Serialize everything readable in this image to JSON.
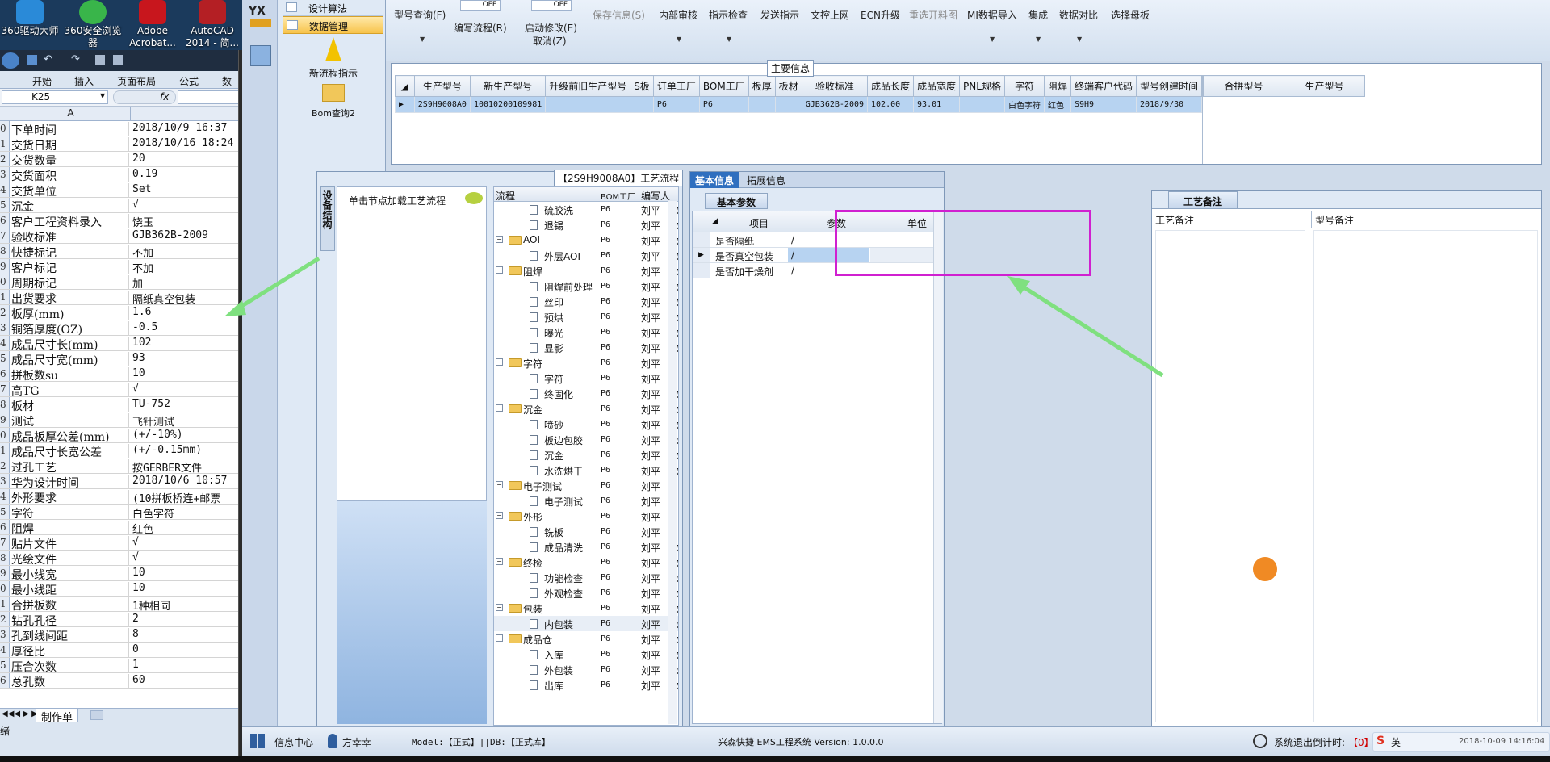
{
  "desktop": {
    "icons": [
      {
        "line1": "360驱动大师",
        "line2": ""
      },
      {
        "line1": "360安全浏览",
        "line2": "器"
      },
      {
        "line1": "Adobe",
        "line2": "Acrobat..."
      },
      {
        "line1": "AutoCAD",
        "line2": "2014 - 简..."
      }
    ]
  },
  "excel": {
    "ribbon_tabs": [
      "开始",
      "插入",
      "页面布局",
      "公式",
      "数据"
    ],
    "name_box": "K25",
    "fx": "fx",
    "column_a": "A",
    "rows": [
      {
        "num": "0",
        "a": "下单时间",
        "b": "2018/10/9 16:37"
      },
      {
        "num": "1",
        "a": "交货日期",
        "b": "2018/10/16 18:24"
      },
      {
        "num": "2",
        "a": "交货数量",
        "b": "20"
      },
      {
        "num": "3",
        "a": "交货面积",
        "b": "0.19"
      },
      {
        "num": "4",
        "a": "交货单位",
        "b": "Set"
      },
      {
        "num": "5",
        "a": "沉金",
        "b": "√"
      },
      {
        "num": "6",
        "a": "客户工程资料录入",
        "b": "饶玉"
      },
      {
        "num": "7",
        "a": "验收标准",
        "b": "GJB362B-2009"
      },
      {
        "num": "8",
        "a": "快捷标记",
        "b": "不加"
      },
      {
        "num": "9",
        "a": "客户标记",
        "b": "不加"
      },
      {
        "num": "0",
        "a": "周期标记",
        "b": "加"
      },
      {
        "num": "1",
        "a": "出货要求",
        "b": "隔纸真空包装"
      },
      {
        "num": "2",
        "a": "板厚(mm)",
        "b": "1.6"
      },
      {
        "num": "3",
        "a": "铜箔厚度(OZ)",
        "b": "-0.5"
      },
      {
        "num": "4",
        "a": "成品尺寸长(mm)",
        "b": "102"
      },
      {
        "num": "5",
        "a": "成品尺寸宽(mm)",
        "b": "93"
      },
      {
        "num": "6",
        "a": "拼板数su",
        "b": "10"
      },
      {
        "num": "7",
        "a": "高TG",
        "b": "√"
      },
      {
        "num": "8",
        "a": "板材",
        "b": "TU-752"
      },
      {
        "num": "9",
        "a": "测试",
        "b": "飞针测试"
      },
      {
        "num": "0",
        "a": "成品板厚公差(mm)",
        "b": "(+/-10%)"
      },
      {
        "num": "1",
        "a": "成品尺寸长宽公差",
        "b": "(+/-0.15mm)"
      },
      {
        "num": "2",
        "a": "过孔工艺",
        "b": "按GERBER文件"
      },
      {
        "num": "3",
        "a": "华为设计时间",
        "b": "2018/10/6 10:57"
      },
      {
        "num": "4",
        "a": "外形要求",
        "b": "(10拼板桥连+邮票"
      },
      {
        "num": "5",
        "a": "字符",
        "b": "白色字符"
      },
      {
        "num": "6",
        "a": "阻焊",
        "b": "红色"
      },
      {
        "num": "7",
        "a": "贴片文件",
        "b": "√"
      },
      {
        "num": "8",
        "a": "光绘文件",
        "b": "√"
      },
      {
        "num": "9",
        "a": "最小线宽",
        "b": "10"
      },
      {
        "num": "0",
        "a": "最小线距",
        "b": "10"
      },
      {
        "num": "1",
        "a": "合拼板数",
        "b": "1种相同"
      },
      {
        "num": "2",
        "a": "钻孔孔径",
        "b": "2"
      },
      {
        "num": "3",
        "a": "孔到线间距",
        "b": "8"
      },
      {
        "num": "4",
        "a": "厚径比",
        "b": "0"
      },
      {
        "num": "5",
        "a": "压合次数",
        "b": "1"
      },
      {
        "num": "6",
        "a": "总孔数",
        "b": "60"
      }
    ],
    "sheet_tab": "制作单",
    "status": "绪"
  },
  "nav": {
    "brand": "YX",
    "items": [
      "设计算法",
      "数据管理"
    ],
    "tools": [
      "新流程指示",
      "Bom查询2"
    ]
  },
  "toolbar": {
    "buttons": [
      {
        "label": "型号查询(F)",
        "disabled": false
      },
      {
        "label": "编写流程(R)",
        "disabled": false,
        "toggle": "OFF"
      },
      {
        "label": "启动修改(E)",
        "label2": "取消(Z)",
        "disabled": false,
        "toggle": "OFF"
      },
      {
        "label": "保存信息(S)",
        "disabled": true
      },
      {
        "label": "内部审核",
        "disabled": false
      },
      {
        "label": "指示检查",
        "disabled": false
      },
      {
        "label": "发送指示",
        "disabled": false
      },
      {
        "label": "文控上网",
        "disabled": false
      },
      {
        "label": "ECN升级",
        "disabled": false
      },
      {
        "label": "重选开料图",
        "disabled": true
      },
      {
        "label": "MI数据导入",
        "disabled": false
      },
      {
        "label": "集成",
        "disabled": false
      },
      {
        "label": "数据对比",
        "disabled": false
      },
      {
        "label": "选择母板",
        "disabled": false
      }
    ]
  },
  "main_info": {
    "title": "主要信息",
    "columns": [
      "生产型号",
      "新生产型号",
      "升级前旧生产型号",
      "S板",
      "订单工厂",
      "BOM工厂",
      "板厚",
      "板材",
      "验收标准",
      "成品长度",
      "成品宽度",
      "PNL规格",
      "字符",
      "阻焊",
      "终端客户代码",
      "型号创建时间"
    ],
    "row": [
      "2S9H9008A0",
      "10010200109981",
      "",
      "",
      "P6",
      "P6",
      "",
      "",
      "GJB362B-2009",
      "102.00",
      "93.01",
      "",
      "白色字符",
      "红色",
      "S9H9",
      "2018/9/30"
    ],
    "side_columns": [
      "合拼型号",
      "生产型号"
    ]
  },
  "process": {
    "title": "【2S9H9008A0】工艺流程",
    "side_tab": "设备结构",
    "hint": "单击节点加载工艺流程",
    "columns": [
      "流程",
      "BOM工厂",
      "编写人",
      "核审"
    ],
    "rows": [
      {
        "level": 2,
        "type": "file",
        "name": "硫胶洗",
        "bom": "P6",
        "writer": "刘平",
        "check": "刘平"
      },
      {
        "level": 2,
        "type": "file",
        "name": "退锡",
        "bom": "P6",
        "writer": "刘平",
        "check": "刘平"
      },
      {
        "level": 1,
        "type": "folder",
        "name": "AOI",
        "bom": "P6",
        "writer": "刘平",
        "check": "刘平"
      },
      {
        "level": 2,
        "type": "file",
        "name": "外层AOI",
        "bom": "P6",
        "writer": "刘平",
        "check": "刘平"
      },
      {
        "level": 1,
        "type": "folder",
        "name": "阻焊",
        "bom": "P6",
        "writer": "刘平",
        "check": "刘平"
      },
      {
        "level": 2,
        "type": "file",
        "name": "阻焊前处理",
        "bom": "P6",
        "writer": "刘平",
        "check": "刘平"
      },
      {
        "level": 2,
        "type": "file",
        "name": "丝印",
        "bom": "P6",
        "writer": "刘平",
        "check": "刘平"
      },
      {
        "level": 2,
        "type": "file",
        "name": "预烘",
        "bom": "P6",
        "writer": "刘平",
        "check": "刘平"
      },
      {
        "level": 2,
        "type": "file",
        "name": "曝光",
        "bom": "P6",
        "writer": "刘平",
        "check": "刘平"
      },
      {
        "level": 2,
        "type": "file",
        "name": "显影",
        "bom": "P6",
        "writer": "刘平",
        "check": "刘平"
      },
      {
        "level": 1,
        "type": "folder",
        "name": "字符",
        "bom": "P6",
        "writer": "刘平",
        "check": ""
      },
      {
        "level": 2,
        "type": "file",
        "name": "字符",
        "bom": "P6",
        "writer": "刘平",
        "check": ""
      },
      {
        "level": 2,
        "type": "file",
        "name": "终固化",
        "bom": "P6",
        "writer": "刘平",
        "check": "刘平"
      },
      {
        "level": 1,
        "type": "folder",
        "name": "沉金",
        "bom": "P6",
        "writer": "刘平",
        "check": "刘平"
      },
      {
        "level": 2,
        "type": "file",
        "name": "喷砂",
        "bom": "P6",
        "writer": "刘平",
        "check": "刘平"
      },
      {
        "level": 2,
        "type": "file",
        "name": "板边包胶",
        "bom": "P6",
        "writer": "刘平",
        "check": "刘平"
      },
      {
        "level": 2,
        "type": "file",
        "name": "沉金",
        "bom": "P6",
        "writer": "刘平",
        "check": "刘平"
      },
      {
        "level": 2,
        "type": "file",
        "name": "水洗烘干",
        "bom": "P6",
        "writer": "刘平",
        "check": "刘平"
      },
      {
        "level": 1,
        "type": "folder",
        "name": "电子测试",
        "bom": "P6",
        "writer": "刘平",
        "check": ""
      },
      {
        "level": 2,
        "type": "file",
        "name": "电子测试",
        "bom": "P6",
        "writer": "刘平",
        "check": ""
      },
      {
        "level": 1,
        "type": "folder",
        "name": "外形",
        "bom": "P6",
        "writer": "刘平",
        "check": ""
      },
      {
        "level": 2,
        "type": "file",
        "name": "铣板",
        "bom": "P6",
        "writer": "刘平",
        "check": ""
      },
      {
        "level": 2,
        "type": "file",
        "name": "成品清洗",
        "bom": "P6",
        "writer": "刘平",
        "check": "刘平"
      },
      {
        "level": 1,
        "type": "folder",
        "name": "终检",
        "bom": "P6",
        "writer": "刘平",
        "check": "刘平"
      },
      {
        "level": 2,
        "type": "file",
        "name": "功能检查",
        "bom": "P6",
        "writer": "刘平",
        "check": "刘平"
      },
      {
        "level": 2,
        "type": "file",
        "name": "外观检查",
        "bom": "P6",
        "writer": "刘平",
        "check": "刘平"
      },
      {
        "level": 1,
        "type": "folder",
        "name": "包装",
        "bom": "P6",
        "writer": "刘平",
        "check": "刘平"
      },
      {
        "level": 2,
        "type": "file",
        "name": "内包装",
        "bom": "P6",
        "writer": "刘平",
        "check": "刘平"
      },
      {
        "level": 1,
        "type": "folder",
        "name": "成品仓",
        "bom": "P6",
        "writer": "刘平",
        "check": "刘平"
      },
      {
        "level": 2,
        "type": "file",
        "name": "入库",
        "bom": "P6",
        "writer": "刘平",
        "check": "刘平"
      },
      {
        "level": 2,
        "type": "file",
        "name": "外包装",
        "bom": "P6",
        "writer": "刘平",
        "check": "刘平"
      },
      {
        "level": 2,
        "type": "file",
        "name": "出库",
        "bom": "P6",
        "writer": "刘平",
        "check": "刘平"
      }
    ]
  },
  "basic": {
    "tabs": [
      "基本信息",
      "拓展信息"
    ],
    "subtab": "基本参数",
    "columns": [
      "项目",
      "参数",
      "单位"
    ],
    "rows": [
      {
        "item": "是否隔纸",
        "param": "/",
        "unit": ""
      },
      {
        "item": "是否真空包装",
        "param": "/",
        "unit": ""
      },
      {
        "item": "是否加干燥剂",
        "param": "/",
        "unit": ""
      }
    ]
  },
  "notes": {
    "tab": "工艺备注",
    "col1": "工艺备注",
    "col2": "型号备注"
  },
  "status": {
    "info_center": "信息中心",
    "user": "方幸幸",
    "model": "Model:【正式】||DB:【正式库】",
    "app_title": "兴森快捷 EMS工程系统 Version: 1.0.0.0",
    "logout_label": "系统退出倒计时:",
    "logout_value": "【0】",
    "clock": "2018-10-09 14:16:04",
    "ime": "英"
  },
  "colors": {
    "highlight_box": "#d020d0",
    "arrow": "#7fe07f",
    "selected_row": "#b7d3f1"
  }
}
